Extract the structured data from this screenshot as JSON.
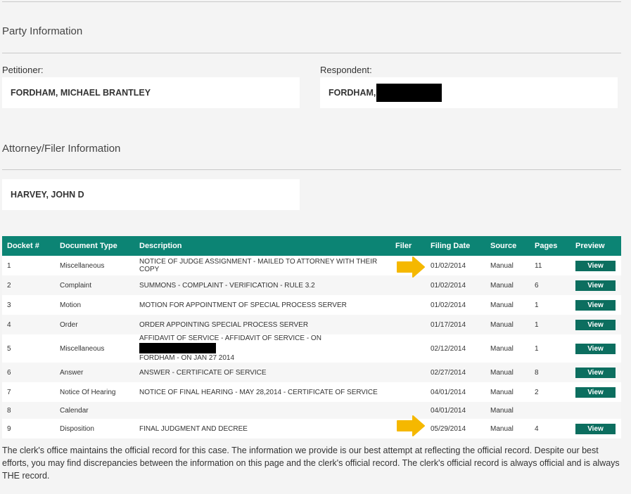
{
  "party": {
    "title": "Party Information",
    "petitioner_label": "Petitioner:",
    "petitioner_name": "FORDHAM, MICHAEL BRANTLEY",
    "respondent_label": "Respondent:",
    "respondent_name": "FORDHAM,"
  },
  "attorney": {
    "title": "Attorney/Filer Information",
    "name": "HARVEY, JOHN D"
  },
  "docket": {
    "headers": [
      "Docket #",
      "Document Type",
      "Description",
      "Filer",
      "Filing Date",
      "Source",
      "Pages",
      "Preview"
    ],
    "rows": [
      {
        "num": "1",
        "type": "Miscellaneous",
        "desc": "NOTICE OF JUDGE ASSIGNMENT - MAILED TO ATTORNEY WITH THEIR COPY",
        "filer": "",
        "date": "01/02/2014",
        "source": "Manual",
        "pages": "11",
        "view": "View"
      },
      {
        "num": "2",
        "type": "Complaint",
        "desc": "SUMMONS - COMPLAINT - VERIFICATION - RULE 3.2",
        "filer": "",
        "date": "01/02/2014",
        "source": "Manual",
        "pages": "6",
        "view": "View"
      },
      {
        "num": "3",
        "type": "Motion",
        "desc": "MOTION FOR APPOINTMENT OF SPECIAL PROCESS SERVER",
        "filer": "",
        "date": "01/02/2014",
        "source": "Manual",
        "pages": "1",
        "view": "View"
      },
      {
        "num": "4",
        "type": "Order",
        "desc": "ORDER APPOINTING SPECIAL PROCESS SERVER",
        "filer": "",
        "date": "01/17/2014",
        "source": "Manual",
        "pages": "1",
        "view": "View"
      },
      {
        "num": "5",
        "type": "Miscellaneous",
        "desc_line1": "AFFIDAVIT OF SERVICE - AFFIDAVIT OF SERVICE - ON",
        "desc_line2": "FORDHAM - ON JAN 27 2014",
        "filer": "",
        "date": "02/12/2014",
        "source": "Manual",
        "pages": "1",
        "view": "View"
      },
      {
        "num": "6",
        "type": "Answer",
        "desc": "ANSWER - CERTIFICATE OF SERVICE",
        "filer": "",
        "date": "02/27/2014",
        "source": "Manual",
        "pages": "8",
        "view": "View"
      },
      {
        "num": "7",
        "type": "Notice Of Hearing",
        "desc": "NOTICE OF FINAL HEARING - MAY 28,2014 - CERTIFICATE OF SERVICE",
        "filer": "",
        "date": "04/01/2014",
        "source": "Manual",
        "pages": "2",
        "view": "View"
      },
      {
        "num": "8",
        "type": "Calendar",
        "desc": "",
        "filer": "",
        "date": "04/01/2014",
        "source": "Manual",
        "pages": "",
        "view": ""
      },
      {
        "num": "9",
        "type": "Disposition",
        "desc": "FINAL JUDGMENT AND DECREE",
        "filer": "",
        "date": "05/29/2014",
        "source": "Manual",
        "pages": "4",
        "view": "View"
      }
    ]
  },
  "footer": {
    "disclaimer": "The clerk's office maintains the official record for this case. The information we provide is our best attempt at reflecting the official record. Despite our best efforts, you may find discrepancies between the information on this page and the clerk's official record. The clerk's official record is always official and is always THE record."
  },
  "colors": {
    "header_bg": "#0c8474",
    "button_bg": "#0c6e5f",
    "arrow": "#f5b800",
    "redaction": "#000000"
  },
  "icons": {
    "annotation_arrow": "arrow-right-icon"
  }
}
